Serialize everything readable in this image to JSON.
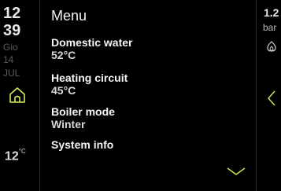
{
  "sidebar": {
    "hour": "12",
    "minute": "39",
    "weekday": "Gio",
    "day": "14",
    "month": "JUL",
    "outside_temp": "12",
    "outside_temp_unit": "°C"
  },
  "menu": {
    "title": "Menu",
    "items": [
      {
        "label": "Domestic water",
        "value": "52°C"
      },
      {
        "label": "Heating circuit",
        "value": "45°C"
      },
      {
        "label": "Boiler mode",
        "value": "Winter"
      },
      {
        "label": "System info",
        "value": ""
      }
    ]
  },
  "right_panel": {
    "pressure": "1.2",
    "unit": "bar"
  },
  "icons": {
    "home": "home-icon",
    "flame": "flame-icon",
    "chevron_down": "chevron-down-icon",
    "chevron_left": "chevron-left-icon"
  },
  "colors": {
    "accent": "#d9e85a",
    "background": "#000000"
  }
}
